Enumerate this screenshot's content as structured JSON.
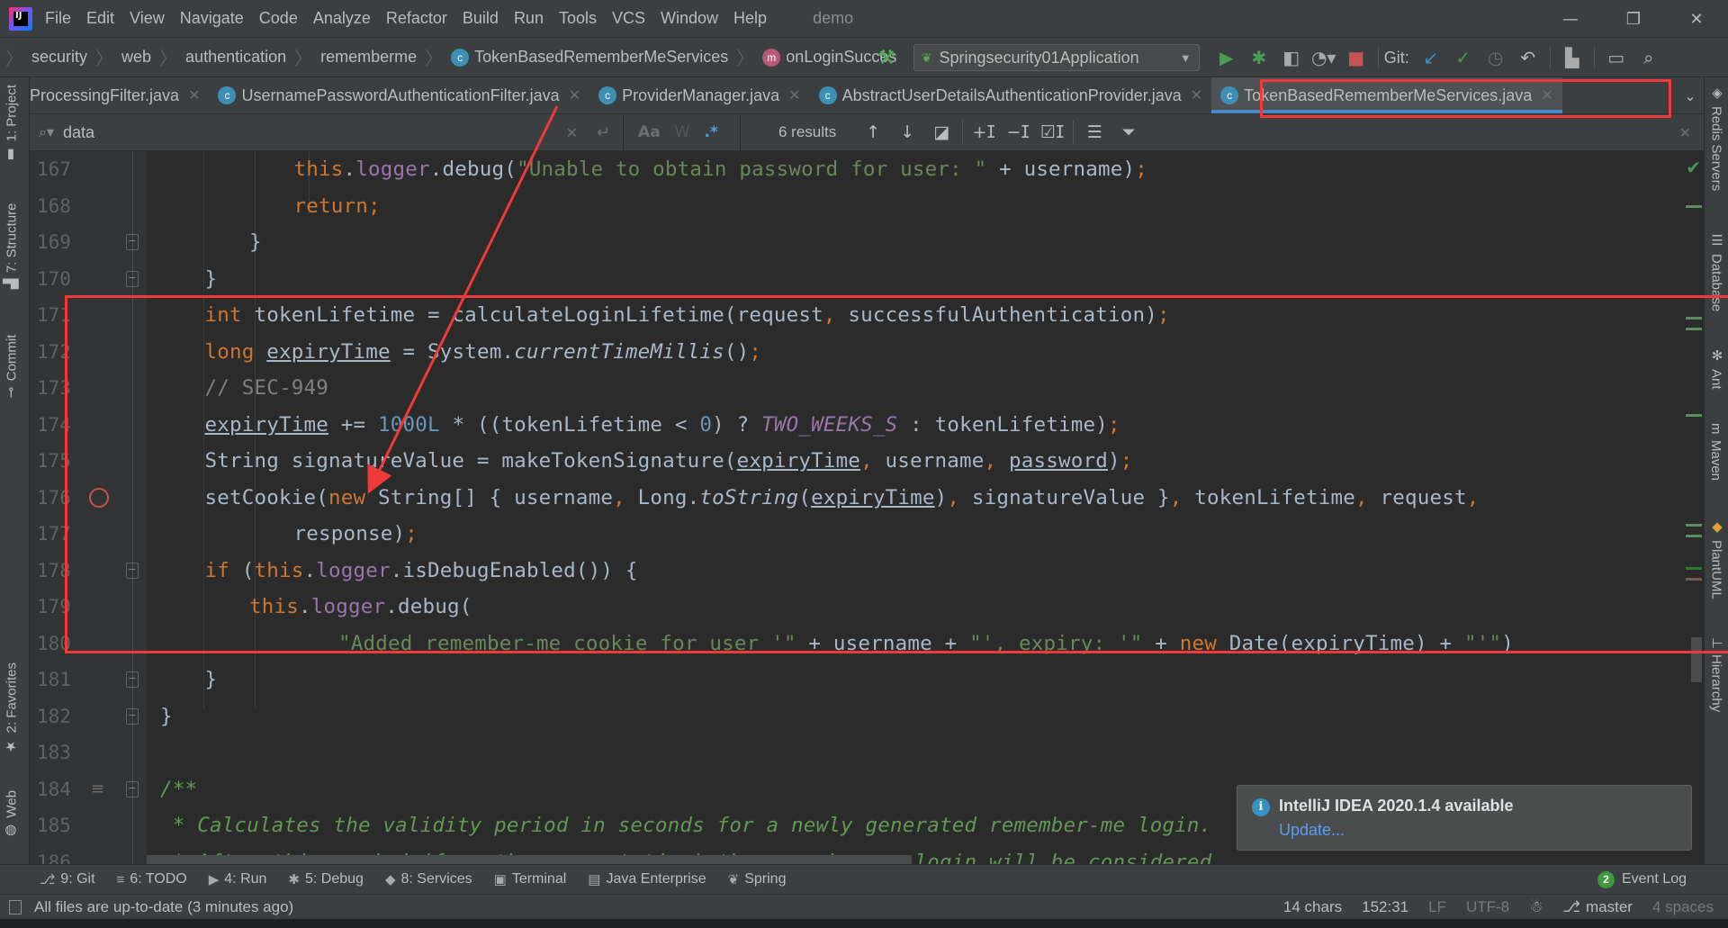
{
  "window": {
    "project_title": "demo",
    "menu": [
      "File",
      "Edit",
      "View",
      "Navigate",
      "Code",
      "Analyze",
      "Refactor",
      "Build",
      "Run",
      "Tools",
      "VCS",
      "Window",
      "Help"
    ],
    "controls": {
      "minimize": "—",
      "restore": "❐",
      "close": "✕"
    }
  },
  "breadcrumb": {
    "items": [
      "security",
      "web",
      "authentication",
      "rememberme"
    ],
    "class_name": "TokenBasedRememberMeServices",
    "method_name": "onLoginSucces"
  },
  "toolbar": {
    "run_config": "Springsecurity01Application",
    "git_label": "Git:"
  },
  "tabs": [
    {
      "label": "ProcessingFilter.java",
      "active": false,
      "has_icon": false
    },
    {
      "label": "UsernamePasswordAuthenticationFilter.java",
      "active": false,
      "has_icon": true
    },
    {
      "label": "ProviderManager.java",
      "active": false,
      "has_icon": true
    },
    {
      "label": "AbstractUserDetailsAuthenticationProvider.java",
      "active": false,
      "has_icon": true
    },
    {
      "label": "TokenBasedRememberMeServices.java",
      "active": true,
      "has_icon": true
    }
  ],
  "find": {
    "query": "data",
    "results": "6 results",
    "match_case": "Aa",
    "words": "W",
    "regex": ".*"
  },
  "left_tools": [
    "1: Project",
    "7: Structure",
    "Commit",
    "2: Favorites",
    "Web"
  ],
  "right_tools": [
    "Redis Servers",
    "Database",
    "Ant",
    "Maven",
    "PlantUML",
    "Hierarchy"
  ],
  "editor": {
    "lines": [
      {
        "n": "167",
        "html": "<span class='kw'>this</span>.<span class='fld'>logger</span>.debug(<span class='str'>\"Unable to obtain password for user: \"</span> + username)<span class='kw'>;</span>",
        "indent": 4
      },
      {
        "n": "168",
        "html": "<span class='kw'>return;</span>",
        "indent": 4
      },
      {
        "n": "169",
        "html": "}",
        "indent": 3
      },
      {
        "n": "170",
        "html": "}",
        "indent": 2
      },
      {
        "n": "171",
        "html": "<span class='kw'>int</span> tokenLifetime = calculateLoginLifetime(request<span class='kw'>,</span> successfulAuthentication)<span class='kw'>;</span>",
        "indent": 2
      },
      {
        "n": "172",
        "html": "<span class='kw'>long</span> <span class='ul'>expiryTime</span> = System.<span class='ital'>currentTimeMillis</span>()<span class='kw'>;</span>",
        "indent": 2
      },
      {
        "n": "173",
        "html": "<span class='cmt'>// SEC-949</span>",
        "indent": 2
      },
      {
        "n": "174",
        "html": "<span class='ul'>expiryTime</span> += <span class='num'>1000L</span> * ((tokenLifetime &lt; <span class='num'>0</span>) ? <span class='const'>TWO_WEEKS_S</span> : tokenLifetime)<span class='kw'>;</span>",
        "indent": 2
      },
      {
        "n": "175",
        "html": "String signatureValue = makeTokenSignature(<span class='ul'>expiryTime</span><span class='kw'>,</span> username<span class='kw'>,</span> <span class='ul'>password</span>)<span class='kw'>;</span>",
        "indent": 2
      },
      {
        "n": "176",
        "html": "setCookie(<span class='kw'>new</span> String[] { username<span class='kw'>,</span> Long.<span class='ital'>toString</span>(<span class='ul'>expiryTime</span>)<span class='kw'>,</span> signatureValue }<span class='kw'>,</span> tokenLifetime<span class='kw'>,</span> request<span class='kw'>,</span>",
        "indent": 2
      },
      {
        "n": "177",
        "html": "response)<span class='kw'>;</span>",
        "indent": 4
      },
      {
        "n": "178",
        "html": "<span class='kw'>if</span> (<span class='kw'>this</span>.<span class='fld'>logger</span>.isDebugEnabled()) {",
        "indent": 2
      },
      {
        "n": "179",
        "html": "<span class='kw'>this</span>.<span class='fld'>logger</span>.debug(",
        "indent": 3
      },
      {
        "n": "180",
        "html": "<span class='str'>\"Added remember-me cookie for user '\"</span> + username + <span class='str'>\"', expiry: '\"</span> + <span class='kw'>new</span> Date(<span class='ul'>expiryTime</span>) + <span class='str'>\"'\"</span>)",
        "indent": 5
      },
      {
        "n": "181",
        "html": "}",
        "indent": 2
      },
      {
        "n": "182",
        "html": "}",
        "indent": 1
      },
      {
        "n": "183",
        "html": "",
        "indent": 0
      },
      {
        "n": "184",
        "html": "<span class='doc'>/**</span>",
        "indent": 1
      },
      {
        "n": "185",
        "html": "<span class='doc'> * Calculates the validity period in seconds for a newly generated remember-me login.</span>",
        "indent": 1
      },
      {
        "n": "186",
        "html": "<span class='doc'> * After this period (from the current time) the remember-me login will be considered</span>",
        "indent": 1
      }
    ]
  },
  "notification": {
    "title": "IntelliJ IDEA 2020.1.4 available",
    "link": "Update..."
  },
  "tool_windows": [
    {
      "icon": "git-icon",
      "glyph": "⎇",
      "label": "9: Git"
    },
    {
      "icon": "todo-icon",
      "glyph": "≡",
      "label": "6: TODO"
    },
    {
      "icon": "run-icon",
      "glyph": "▶",
      "label": "4: Run"
    },
    {
      "icon": "debug-icon",
      "glyph": "✱",
      "label": "5: Debug"
    },
    {
      "icon": "services-icon",
      "glyph": "◆",
      "label": "8: Services"
    },
    {
      "icon": "terminal-icon",
      "glyph": "▣",
      "label": "Terminal"
    },
    {
      "icon": "java-enterprise-icon",
      "glyph": "▤",
      "label": "Java Enterprise"
    },
    {
      "icon": "spring-icon",
      "glyph": "❦",
      "label": "Spring"
    }
  ],
  "event_log": {
    "count": "2",
    "label": "Event Log"
  },
  "status": {
    "message": "All files are up-to-date (3 minutes ago)",
    "selection": "14 chars",
    "position": "152:31",
    "line_sep": "LF",
    "encoding": "UTF-8",
    "branch": "master",
    "indent": "4 spaces"
  },
  "colors": {
    "annotation": "#f03a3a",
    "accent": "#4a88c7"
  }
}
